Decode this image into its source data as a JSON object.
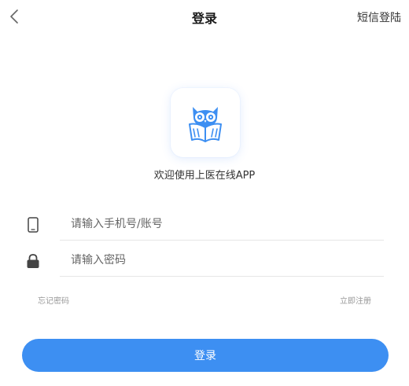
{
  "nav": {
    "title": "登录",
    "sms_login_label": "短信登陆",
    "back_icon": "chevron-left-icon"
  },
  "brand": {
    "logo_icon": "owl-book-logo",
    "welcome_text": "欢迎使用上医在线APP",
    "accent_color": "#3d8ff2"
  },
  "form": {
    "phone": {
      "icon": "phone-icon",
      "placeholder": "请输入手机号/账号",
      "value": ""
    },
    "password": {
      "icon": "lock-icon",
      "placeholder": "请输入密码",
      "value": ""
    },
    "forgot_label": "忘记密码",
    "register_label": "立即注册",
    "submit_label": "登录"
  }
}
